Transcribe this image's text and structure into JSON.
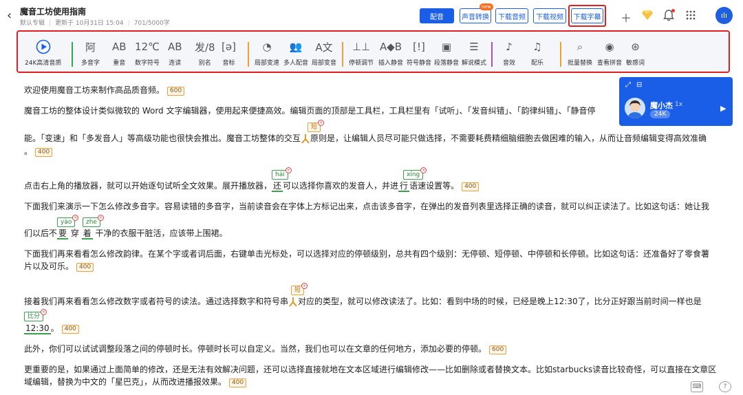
{
  "header": {
    "title": "魔音工坊使用指南",
    "album": "默认专辑",
    "updated": "更新于 10月31日 15:04",
    "wordcount": "701/5000字",
    "buttons": {
      "dub": "配音",
      "voice_convert": "声音转换",
      "new_badge": "new",
      "download_audio": "下载音频",
      "download_video": "下载视频",
      "download_subtitle": "下载字幕"
    },
    "avatar_text": "ılı"
  },
  "toolbar": {
    "items": [
      {
        "label": "24K高清音质",
        "glyph": "▶"
      },
      {
        "label": "多音字",
        "glyph": "阿"
      },
      {
        "label": "重音",
        "glyph": "AB"
      },
      {
        "label": "数字符号",
        "glyph": "12℃"
      },
      {
        "label": "连读",
        "glyph": "AB"
      },
      {
        "label": "别名",
        "glyph": "发/8"
      },
      {
        "label": "音标",
        "glyph": "[ə]"
      },
      {
        "label": "局部变速",
        "glyph": "◔"
      },
      {
        "label": "多人配音",
        "glyph": "👥"
      },
      {
        "label": "局部变音",
        "glyph": "A文"
      },
      {
        "label": "停顿调节",
        "glyph": "⊥⊥"
      },
      {
        "label": "插入静音",
        "glyph": "A◆B"
      },
      {
        "label": "符号静音",
        "glyph": "[!]"
      },
      {
        "label": "段落静音",
        "glyph": "▣"
      },
      {
        "label": "解说模式",
        "glyph": "☰"
      },
      {
        "label": "音效",
        "glyph": "♪"
      },
      {
        "label": "配乐",
        "glyph": "♫"
      },
      {
        "label": "批量替换",
        "glyph": "⌕"
      },
      {
        "label": "查看拼音",
        "glyph": "◉"
      },
      {
        "label": "敏感词",
        "glyph": "⊛"
      }
    ]
  },
  "content": {
    "l1": "欢迎使用魔音工坊来制作高品质音频。",
    "l1c": "600",
    "l2": "魔音工坊的整体设计类似微软的 Word 文字编辑器，使用起来便捷高效。编辑页面的顶部是工具栏，工具栏里有「试听」、「发音纠错」、「韵律纠错」、「静音停",
    "l3a": "能。「变速」和「多发音人」等高级功能也很快会推出。魔音工坊整体的交互",
    "l3b": "原则是，让编辑人员尽可能只做选择，不需要耗费精细脑细胞去做困难的输入，从而让音频编辑变得高效准确",
    "l3tag": "短",
    "l4": "。",
    "l4c": "400",
    "l5a": "点击右上角的播放器，就可以开始逐句试听全文效果。展开播放器，",
    "l5w1": "还",
    "l5t1": "hái",
    "l5b": "可以选择你喜欢的发音人，并进",
    "l5w2": "行",
    "l5t2": "xíng",
    "l5c": "语速设置等。",
    "l5cnt": "400",
    "l6": "下面我们来演示一下怎么修改多音字。容易读错的多音字，当前读音会在字体上方标记出来，点击该多音字，在弹出的发音列表里选择正确的读音，就可以纠正读法了。比如这句话：她让我",
    "l7a": "们以后不",
    "l7w1": "要",
    "l7t1": "yào",
    "l7b": "穿",
    "l7w2": "着",
    "l7t2": "zhe",
    "l7c": "干净的衣服干脏活，应该带上围裙。",
    "l8": "下面我们再来看看怎么修改韵律。在某个字或者词后面，右键单击光标处，可以选择对应的停顿级别，总共有四个级别：无停顿、短停顿、中停顿和长停顿。比如这句话：还准备好了零食薯",
    "l9": "片以及可乐。",
    "l9c": "400",
    "l10a": "接着我们再来看看怎么修改数字或者符号的读法。通过选择数字和符号串",
    "l10b": "对应的类型，就可以修改读法了。比如：看到中场的时候，已经是晚上12:30了，比分正好跟当前时间一样也是",
    "l10tag": "短",
    "l11": "12:30",
    "l11tag": "比分",
    "l11end": "。",
    "l11c": "400",
    "l12": "此外，你们可以试试调整段落之间的停顿时长。停顿时长可以自定义。当然，我们也可以在文章的任何地方，添加必要的停顿。",
    "l12c": "600",
    "l13": "更重要的是，如果通过上面简单的修改，还是无法有效解决问题，还可以选择直接就地在文本区域进行编辑修改——比如删除或者替换文本。比如starbucks读音比较奇怪，可以直接在文章区",
    "l14": "域编辑，替换为中文的「星巴克」，从而改进播报效果。",
    "l14c": "400"
  },
  "player": {
    "name": "魔小杰",
    "speed": "1x",
    "badge": "24K"
  },
  "colors": {
    "primary": "#1a5ee8",
    "highlight_red": "#e02020",
    "toolbar_bg": "#f4f6fa",
    "divider_green": "#2fa84f",
    "divider_orange": "#f0a030",
    "divider_purple": "#a050d0"
  }
}
